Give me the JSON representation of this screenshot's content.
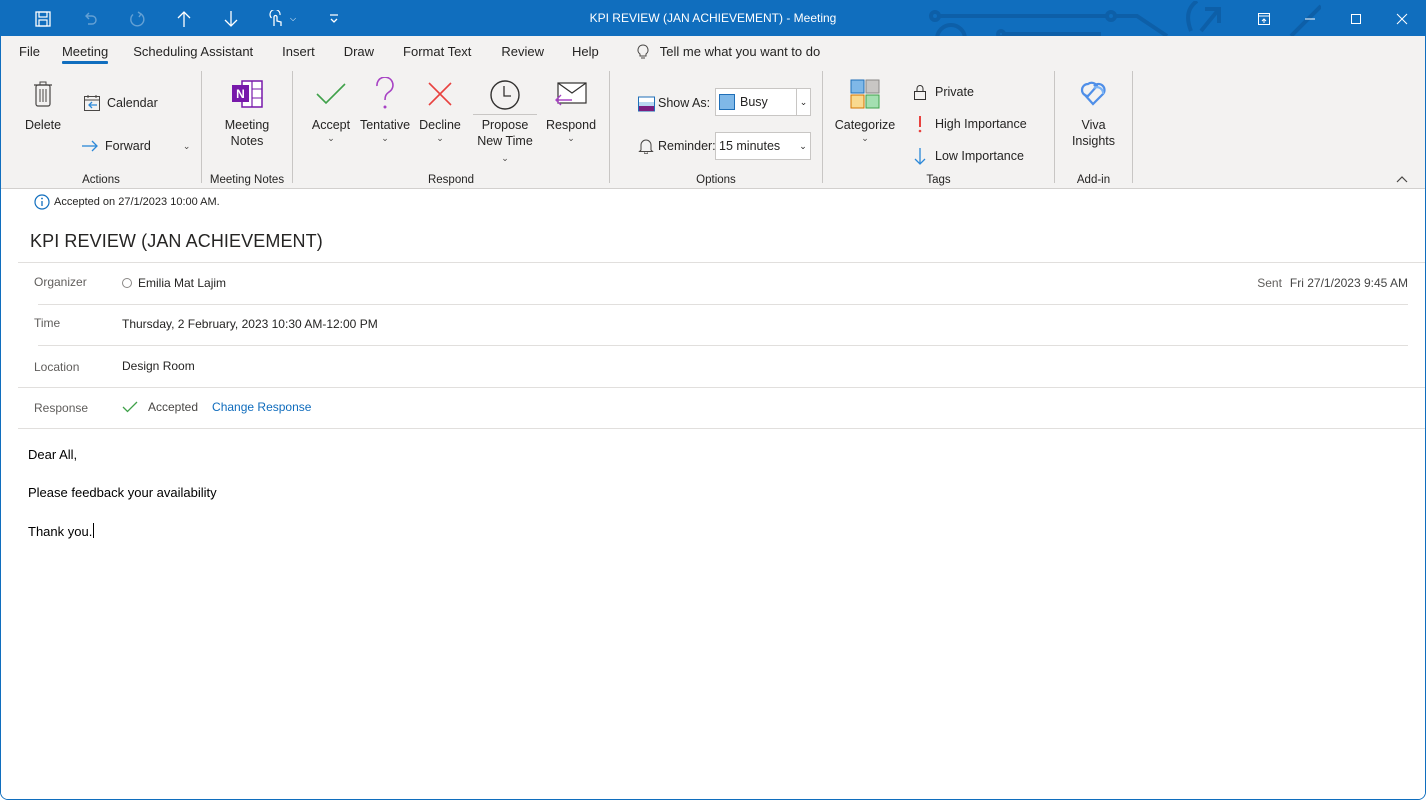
{
  "window": {
    "title": "KPI REVIEW (JAN ACHIEVEMENT)",
    "title_separator": " - ",
    "app_context": "Meeting",
    "controls": {
      "restore_ribbon": "ribbon-display-icon",
      "minimize": "minimize-icon",
      "maximize": "maximize-icon",
      "close": "close-icon"
    }
  },
  "quick_access": [
    {
      "name": "save",
      "icon": "save-icon",
      "enabled": true
    },
    {
      "name": "undo",
      "icon": "undo-icon",
      "enabled": false
    },
    {
      "name": "redo",
      "icon": "redo-icon",
      "enabled": false
    },
    {
      "name": "previous-item",
      "icon": "arrow-up-icon",
      "enabled": true
    },
    {
      "name": "next-item",
      "icon": "arrow-down-icon",
      "enabled": true
    },
    {
      "name": "touch-mode",
      "icon": "touch-mode-icon",
      "enabled": true
    },
    {
      "name": "customize",
      "icon": "customize-qat-icon",
      "enabled": true
    }
  ],
  "tabs": [
    {
      "label": "File",
      "active": false
    },
    {
      "label": "Meeting",
      "active": true
    },
    {
      "label": "Scheduling Assistant",
      "active": false
    },
    {
      "label": "Insert",
      "active": false
    },
    {
      "label": "Draw",
      "active": false
    },
    {
      "label": "Format Text",
      "active": false
    },
    {
      "label": "Review",
      "active": false
    },
    {
      "label": "Help",
      "active": false
    }
  ],
  "tell_me": {
    "placeholder": "Tell me what you want to do"
  },
  "ribbon": {
    "actions": {
      "label": "Actions",
      "delete": "Delete",
      "calendar": "Calendar",
      "forward": "Forward"
    },
    "meeting_notes": {
      "label": "Meeting Notes",
      "button_line1": "Meeting",
      "button_line2": "Notes"
    },
    "respond": {
      "label": "Respond",
      "accept": "Accept",
      "tentative": "Tentative",
      "decline": "Decline",
      "propose_line1": "Propose",
      "propose_line2": "New Time",
      "respond": "Respond"
    },
    "options": {
      "label": "Options",
      "show_as_label": "Show As:",
      "show_as_value": "Busy",
      "show_as_color": "#7fb8e8",
      "reminder_label": "Reminder:",
      "reminder_value": "15 minutes"
    },
    "tags": {
      "label": "Tags",
      "categorize": "Categorize",
      "private": "Private",
      "high_importance": "High Importance",
      "low_importance": "Low Importance",
      "category_colors": [
        "#7fb8e8",
        "#c8c6c4",
        "#f9d98f",
        "#a4dfb1"
      ]
    },
    "addin": {
      "label": "Add-in",
      "viva_line1": "Viva",
      "viva_line2": "Insights"
    }
  },
  "meeting": {
    "info_bar": "Accepted on 27/1/2023 10:00 AM.",
    "subject": "KPI REVIEW (JAN ACHIEVEMENT)",
    "organizer_label": "Organizer",
    "organizer": "Emilia Mat Lajim",
    "sent_label": "Sent",
    "sent_value": "Fri 27/1/2023 9:45 AM",
    "time_label": "Time",
    "time_value": "Thursday, 2 February, 2023 10:30 AM-12:00 PM",
    "location_label": "Location",
    "location_value": "Design Room",
    "response_label": "Response",
    "response_value": "Accepted",
    "change_response": "Change Response"
  },
  "body": {
    "lines": [
      "Dear All,",
      "Please feedback your availability",
      "Thank you."
    ]
  },
  "colors": {
    "accent": "#106ebe",
    "accept_green": "#3fa14a",
    "tentative_purple": "#a742c4",
    "decline_red": "#e8423f",
    "high_importance_red": "#e8423f",
    "low_importance_blue": "#2b88d8",
    "onenote_purple": "#7719aa"
  }
}
